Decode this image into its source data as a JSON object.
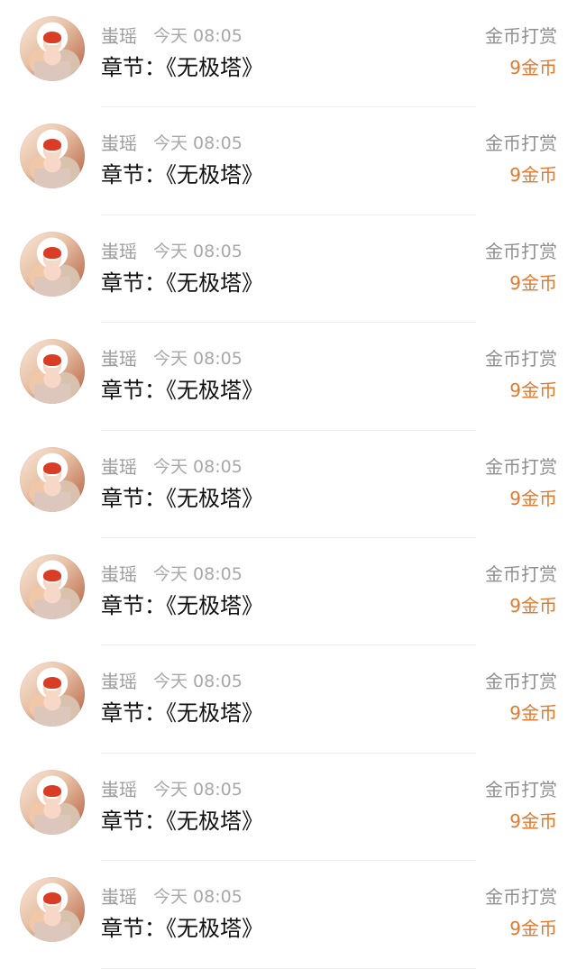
{
  "items": [
    {
      "user": "蚩瑶",
      "time": "今天 08:05",
      "action": "金币打赏",
      "chapter": "章节：《无极塔》",
      "amount": "9金币",
      "avatar_icon": "user-avatar-icon"
    },
    {
      "user": "蚩瑶",
      "time": "今天 08:05",
      "action": "金币打赏",
      "chapter": "章节：《无极塔》",
      "amount": "9金币",
      "avatar_icon": "user-avatar-icon"
    },
    {
      "user": "蚩瑶",
      "time": "今天 08:05",
      "action": "金币打赏",
      "chapter": "章节：《无极塔》",
      "amount": "9金币",
      "avatar_icon": "user-avatar-icon"
    },
    {
      "user": "蚩瑶",
      "time": "今天 08:05",
      "action": "金币打赏",
      "chapter": "章节：《无极塔》",
      "amount": "9金币",
      "avatar_icon": "user-avatar-icon"
    },
    {
      "user": "蚩瑶",
      "time": "今天 08:05",
      "action": "金币打赏",
      "chapter": "章节：《无极塔》",
      "amount": "9金币",
      "avatar_icon": "user-avatar-icon"
    },
    {
      "user": "蚩瑶",
      "time": "今天 08:05",
      "action": "金币打赏",
      "chapter": "章节：《无极塔》",
      "amount": "9金币",
      "avatar_icon": "user-avatar-icon"
    },
    {
      "user": "蚩瑶",
      "time": "今天 08:05",
      "action": "金币打赏",
      "chapter": "章节：《无极塔》",
      "amount": "9金币",
      "avatar_icon": "user-avatar-icon"
    },
    {
      "user": "蚩瑶",
      "time": "今天 08:05",
      "action": "金币打赏",
      "chapter": "章节：《无极塔》",
      "amount": "9金币",
      "avatar_icon": "user-avatar-icon"
    },
    {
      "user": "蚩瑶",
      "time": "今天 08:05",
      "action": "金币打赏",
      "chapter": "章节：《无极塔》",
      "amount": "9金币",
      "avatar_icon": "user-avatar-icon"
    }
  ],
  "colors": {
    "background": "#ffffff",
    "primary_text": "#111111",
    "secondary_text": "#9c9c9c",
    "amount": "#e3782d",
    "divider": "#efefef"
  }
}
